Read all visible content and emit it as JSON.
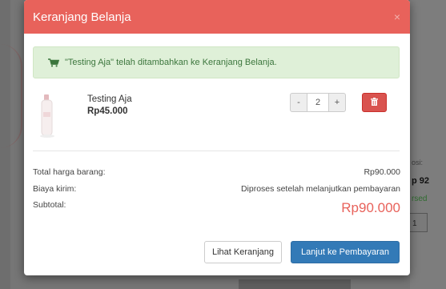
{
  "modal": {
    "title": "Keranjang Belanja",
    "close_label": "×"
  },
  "alert": {
    "message": "\"Testing Aja\" telah ditambahkan ke Keranjang Belanja."
  },
  "cart_item": {
    "name": "Testing Aja",
    "price": "Rp45.000",
    "quantity": "2",
    "minus_label": "-",
    "plus_label": "+"
  },
  "summary": {
    "total_label": "Total harga barang:",
    "total_value": "Rp90.000",
    "shipping_label": "Biaya kirim:",
    "shipping_value": "Diproses setelah melanjutkan pembayaran",
    "subtotal_label": "Subtotal:",
    "subtotal_value": "Rp90.000"
  },
  "actions": {
    "view_cart_label": "Lihat Keranjang",
    "checkout_label": "Lanjut ke Pembayaran"
  },
  "background": {
    "fragment_1": "osi:",
    "fragment_2": "p 92",
    "fragment_3": "rsed",
    "fragment_4": "1"
  },
  "colors": {
    "header": "#e8625b",
    "alert_bg": "#dff0d8",
    "alert_text": "#3c763d",
    "delete": "#d9534f",
    "primary": "#337ab7",
    "subtotal": "#e8625b"
  },
  "icons": {
    "cart": "cart-icon",
    "delete": "trash-icon",
    "close": "close-icon"
  }
}
